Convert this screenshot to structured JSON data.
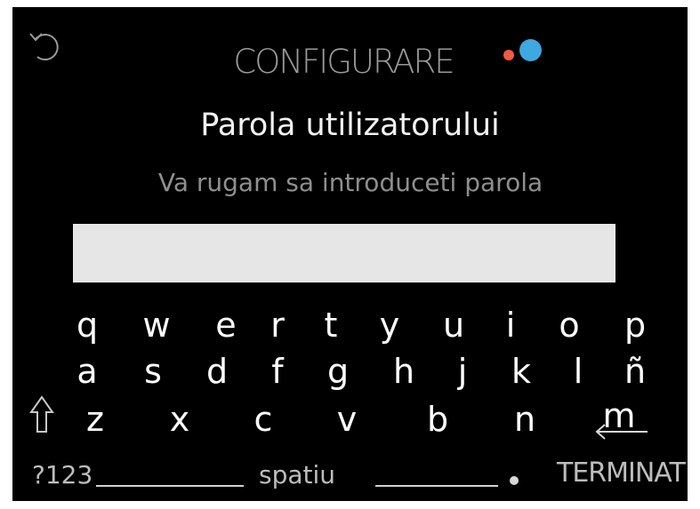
{
  "header": {
    "title": "CONFIGURARE",
    "back_icon": "undo-arrow-icon",
    "dot_colors": [
      "#f05a44",
      "#3ea8e0"
    ]
  },
  "form": {
    "heading": "Parola utilizatorului",
    "instruction": "Va rugam sa introduceti parola",
    "password_value": ""
  },
  "keyboard": {
    "row1": [
      "q",
      "w",
      "e",
      "r",
      "t",
      "y",
      "u",
      "i",
      "o",
      "p"
    ],
    "row2": [
      "a",
      "s",
      "d",
      "f",
      "g",
      "h",
      "j",
      "k",
      "l",
      "ñ"
    ],
    "row3": [
      "z",
      "x",
      "c",
      "v",
      "b",
      "n",
      "m"
    ],
    "shift_icon": "shift-arrow-icon",
    "backspace_icon": "backspace-arrow-icon",
    "numbers_label": "?123",
    "space_label": "spatiu",
    "period_label": ".",
    "done_label": "TERMINAT"
  }
}
